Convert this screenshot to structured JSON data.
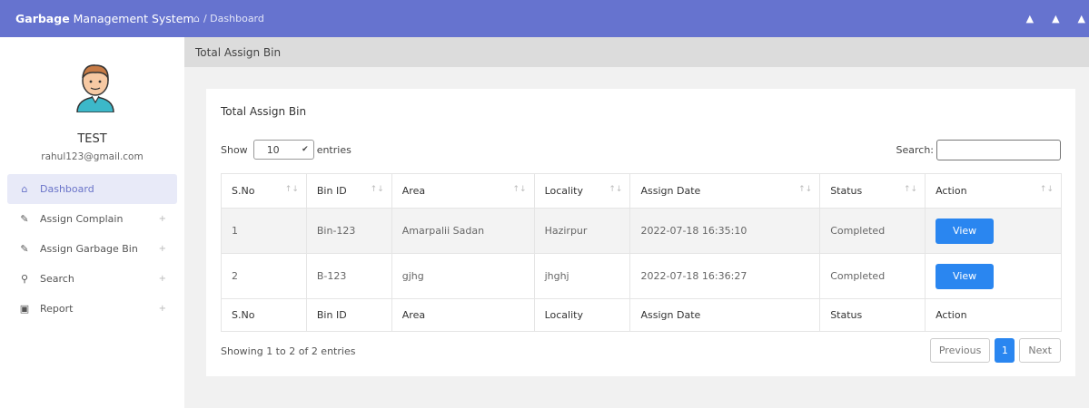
{
  "topbar": {
    "brand_bold": "Garbage",
    "brand_rest": " Management System",
    "breadcrumb": "/ Dashboard",
    "icons": [
      "bell-icon",
      "bell-icon",
      "user-icon"
    ]
  },
  "sidebar": {
    "user_name": "TEST",
    "user_email": "rahul123@gmail.com",
    "items": [
      {
        "label": "Dashboard",
        "icon": "home-icon",
        "active": true
      },
      {
        "label": "Assign Complain",
        "icon": "edit-icon"
      },
      {
        "label": "Assign Garbage Bin",
        "icon": "edit-icon"
      },
      {
        "label": "Search",
        "icon": "search-icon"
      },
      {
        "label": "Report",
        "icon": "lock-icon"
      }
    ]
  },
  "page": {
    "header": "Total Assign Bin",
    "card_title": "Total Assign Bin",
    "show_label": "Show",
    "entries_value": "10",
    "entries_label": "entries",
    "search_label": "Search:",
    "info": "Showing 1 to 2 of 2 entries",
    "pager": {
      "prev": "Previous",
      "current": "1",
      "next": "Next"
    }
  },
  "table": {
    "columns": [
      "S.No",
      "Bin ID",
      "Area",
      "Locality",
      "Assign Date",
      "Status",
      "Action"
    ],
    "rows": [
      {
        "sno": "1",
        "bin": "Bin-123",
        "area": "Amarpalii Sadan",
        "locality": "Hazirpur",
        "date": "2022-07-18 16:35:10",
        "status": "Completed",
        "action": "View"
      },
      {
        "sno": "2",
        "bin": "B-123",
        "area": "gjhg",
        "locality": "jhghj",
        "date": "2022-07-18 16:36:27",
        "status": "Completed",
        "action": "View"
      }
    ]
  },
  "colors": {
    "primary": "#6673cf",
    "button": "#2a86f0"
  }
}
